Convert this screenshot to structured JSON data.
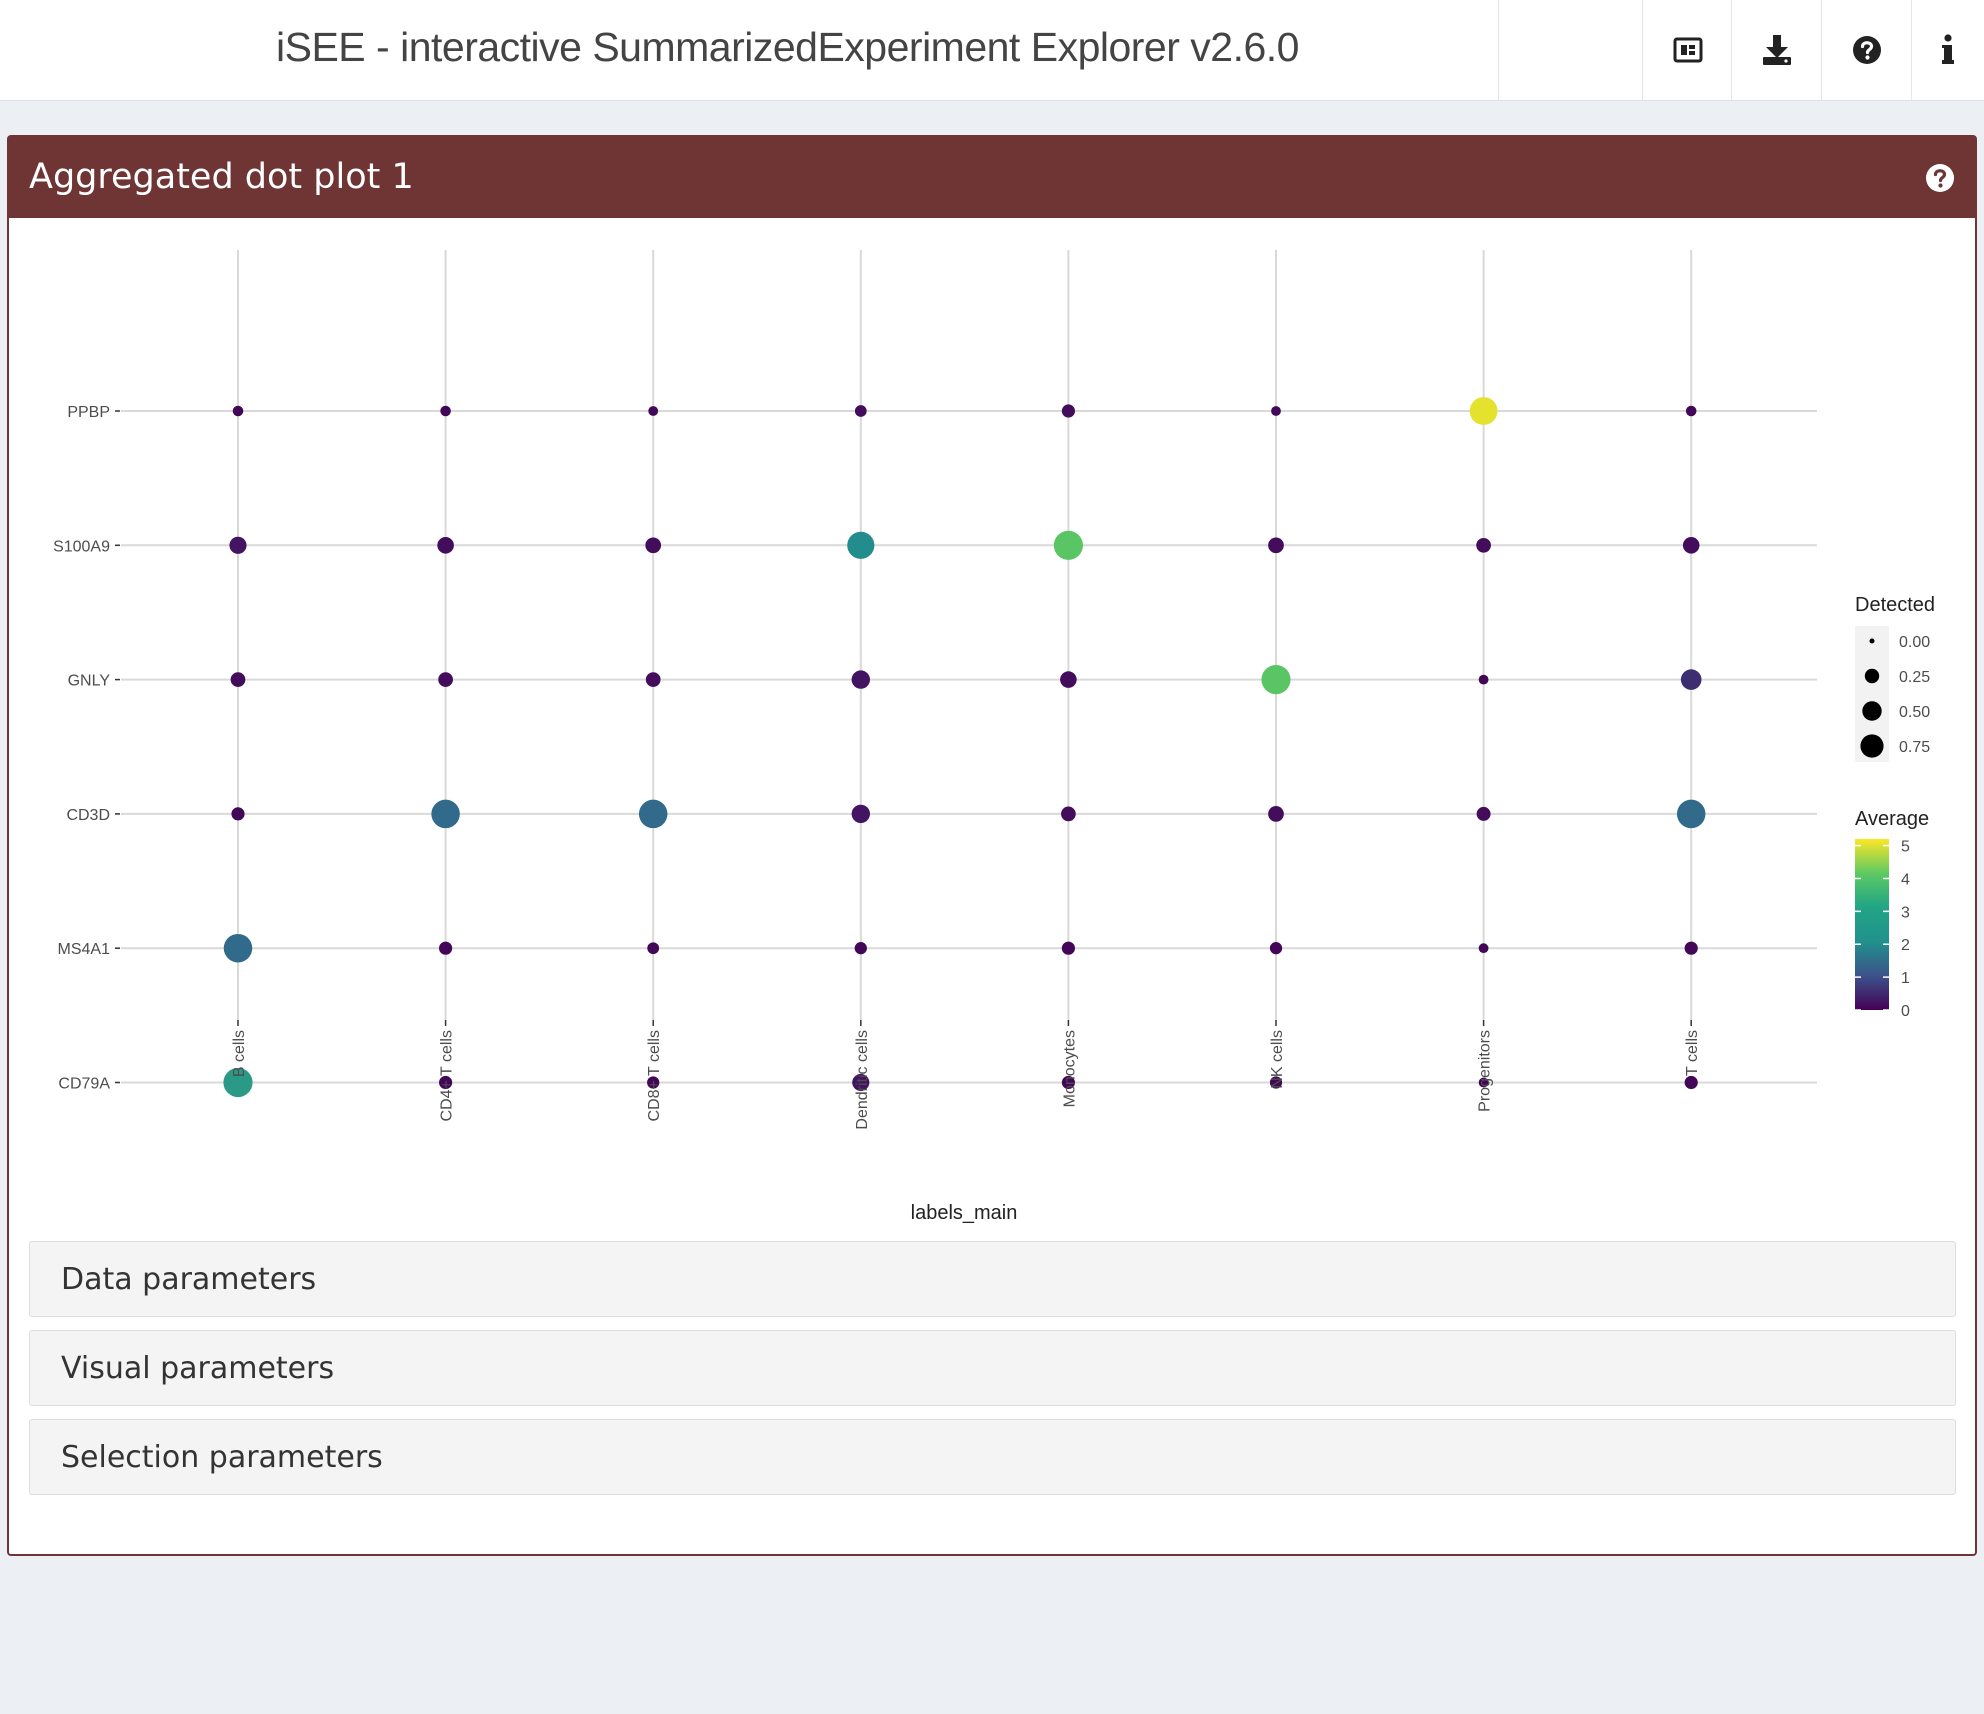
{
  "header": {
    "title": "iSEE - interactive SummarizedExperiment Explorer v2.6.0",
    "buttons": [
      {
        "icon": "panel-organization-icon"
      },
      {
        "icon": "download-icon"
      },
      {
        "icon": "question-circle-icon"
      },
      {
        "icon": "info-icon"
      }
    ]
  },
  "panel": {
    "title": "Aggregated dot plot 1",
    "help_icon": "question-circle-icon",
    "header_color": "#6f3535"
  },
  "params": {
    "data": "Data parameters",
    "visual": "Visual parameters",
    "selection": "Selection parameters"
  },
  "chart_data": {
    "type": "dotplot",
    "xlabel": "labels_main",
    "ylabel": "",
    "categories_x": [
      "B cells",
      "CD4+ T cells",
      "CD8+ T cells",
      "Dendritic cells",
      "Monocytes",
      "NK cells",
      "Progenitors",
      "T cells"
    ],
    "categories_y": [
      "PPBP",
      "S100A9",
      "GNLY",
      "CD3D",
      "MS4A1",
      "CD79A"
    ],
    "grid": true,
    "color_scale": "viridis",
    "average": [
      [
        0.1,
        0.1,
        0.1,
        0.2,
        0.2,
        0.1,
        5.0,
        0.1
      ],
      [
        0.3,
        0.2,
        0.2,
        2.5,
        3.8,
        0.2,
        0.2,
        0.2
      ],
      [
        0.2,
        0.2,
        0.2,
        0.3,
        0.2,
        3.8,
        0.1,
        0.7
      ],
      [
        0.1,
        1.8,
        1.8,
        0.3,
        0.2,
        0.2,
        0.2,
        1.8
      ],
      [
        1.8,
        0.1,
        0.1,
        0.1,
        0.1,
        0.1,
        0.1,
        0.1
      ],
      [
        2.8,
        0.1,
        0.1,
        0.3,
        0.1,
        0.1,
        0.05,
        0.1
      ]
    ],
    "detected": [
      [
        0.03,
        0.03,
        0.02,
        0.05,
        0.08,
        0.02,
        0.8,
        0.03
      ],
      [
        0.2,
        0.18,
        0.15,
        0.75,
        0.9,
        0.15,
        0.12,
        0.18
      ],
      [
        0.12,
        0.12,
        0.12,
        0.25,
        0.18,
        0.9,
        0.02,
        0.35
      ],
      [
        0.08,
        0.85,
        0.85,
        0.25,
        0.12,
        0.15,
        0.1,
        0.85
      ],
      [
        0.85,
        0.08,
        0.05,
        0.06,
        0.08,
        0.06,
        0.02,
        0.08
      ],
      [
        0.9,
        0.08,
        0.06,
        0.2,
        0.08,
        0.06,
        0.02,
        0.08
      ]
    ],
    "legend_size": {
      "title": "Detected",
      "labels": [
        "0.00",
        "0.25",
        "0.50",
        "0.75"
      ],
      "values": [
        0.0,
        0.25,
        0.5,
        0.75
      ]
    },
    "legend_color": {
      "title": "Average",
      "labels": [
        "5",
        "4",
        "3",
        "2",
        "1",
        "0"
      ],
      "values": [
        5,
        4,
        3,
        2,
        1,
        0
      ],
      "range": [
        0,
        5.2
      ]
    },
    "legend_placement": "right"
  }
}
